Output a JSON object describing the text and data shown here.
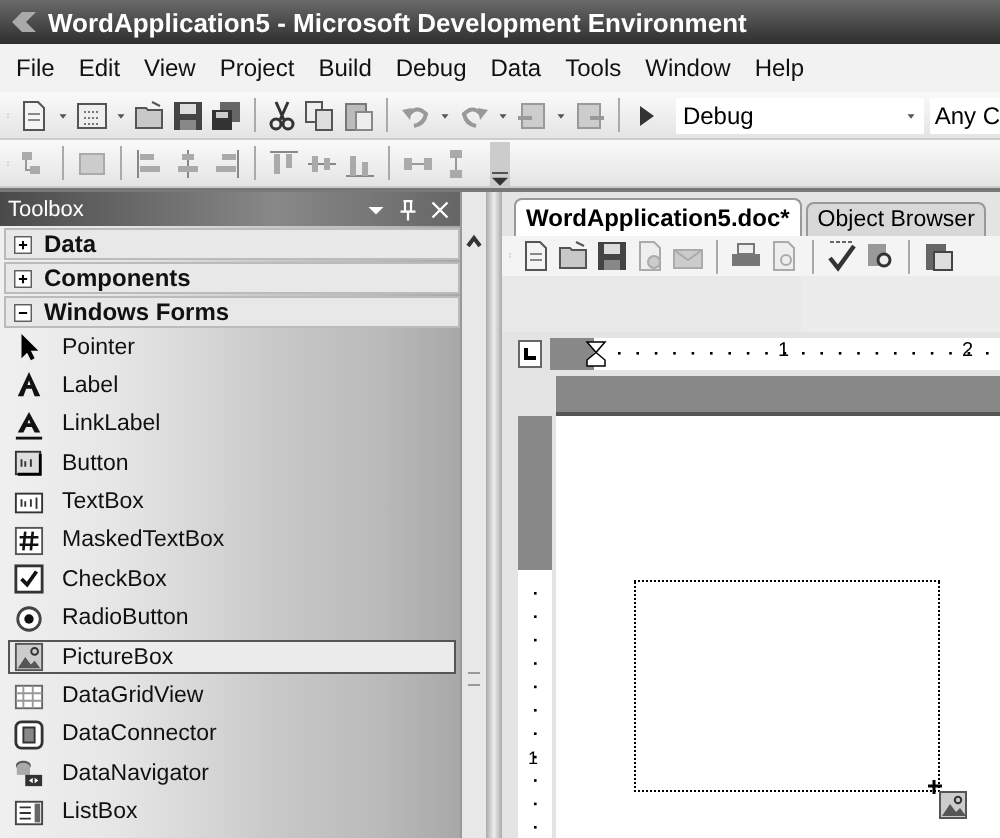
{
  "window": {
    "title": "WordApplication5 - Microsoft Development Environment"
  },
  "menu": [
    "File",
    "Edit",
    "View",
    "Project",
    "Build",
    "Debug",
    "Data",
    "Tools",
    "Window",
    "Help"
  ],
  "toolbar": {
    "configuration": "Debug",
    "platform": "Any C"
  },
  "toolbox": {
    "title": "Toolbox",
    "groups": [
      {
        "label": "Data",
        "expanded": false
      },
      {
        "label": "Components",
        "expanded": false
      },
      {
        "label": "Windows Forms",
        "expanded": true,
        "items": [
          {
            "label": "Pointer",
            "selected": false
          },
          {
            "label": "Label",
            "selected": false
          },
          {
            "label": "LinkLabel",
            "selected": false
          },
          {
            "label": "Button",
            "selected": false
          },
          {
            "label": "TextBox",
            "selected": false
          },
          {
            "label": "MaskedTextBox",
            "selected": false
          },
          {
            "label": "CheckBox",
            "selected": false
          },
          {
            "label": "RadioButton",
            "selected": false
          },
          {
            "label": "PictureBox",
            "selected": true
          },
          {
            "label": "DataGridView",
            "selected": false
          },
          {
            "label": "DataConnector",
            "selected": false
          },
          {
            "label": "DataNavigator",
            "selected": false
          },
          {
            "label": "ListBox",
            "selected": false
          }
        ]
      }
    ]
  },
  "document": {
    "tabs": [
      {
        "label": "WordApplication5.doc*",
        "selected": true
      },
      {
        "label": "Object Browser",
        "selected": false
      }
    ],
    "ruler": {
      "labels": [
        "1",
        "2"
      ]
    },
    "vertical_ruler": {
      "labels": [
        "1"
      ]
    }
  }
}
